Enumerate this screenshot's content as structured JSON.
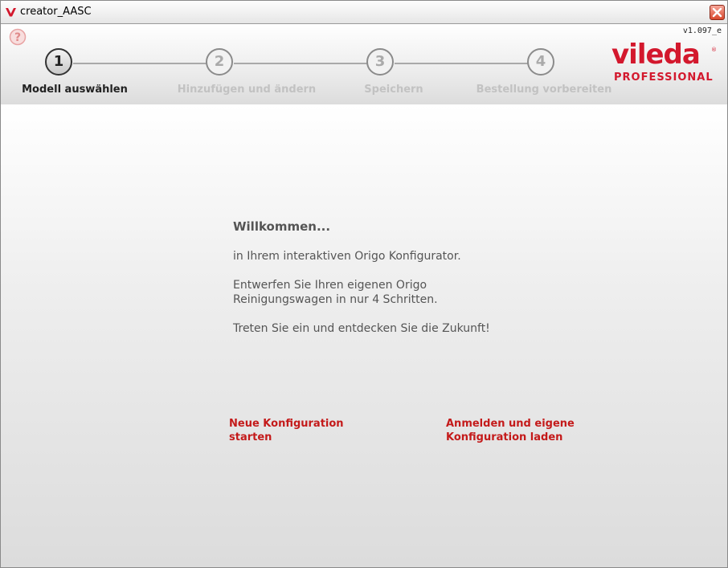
{
  "window": {
    "title": "creator_AASC"
  },
  "header": {
    "version": "v1.097_e",
    "steps": [
      {
        "number": "1",
        "label": "Modell auswählen",
        "active": true
      },
      {
        "number": "2",
        "label": "Hinzufügen und ändern",
        "active": false
      },
      {
        "number": "3",
        "label": "Speichern",
        "active": false
      },
      {
        "number": "4",
        "label": "Bestellung vorbereiten",
        "active": false
      }
    ],
    "logo": {
      "brand": "vileda",
      "sub": "PROFESSIONAL",
      "registered": "®"
    }
  },
  "main": {
    "welcome_title": "Willkommen...",
    "intro": "in Ihrem interaktiven Origo Konfigurator.",
    "design_line1": "Entwerfen Sie Ihren eigenen Origo",
    "design_line2": "Reinigungswagen in nur 4 Schritten.",
    "invite": "Treten Sie ein und entdecken Sie die Zukunft!",
    "new_config_line1": "Neue Konfiguration",
    "new_config_line2": "starten",
    "login_line1": "Anmelden und eigene",
    "login_line2": "Konfiguration laden"
  },
  "colors": {
    "brand_red": "#d3182d",
    "link_red": "#c41a1a",
    "text_gray": "#555555"
  }
}
